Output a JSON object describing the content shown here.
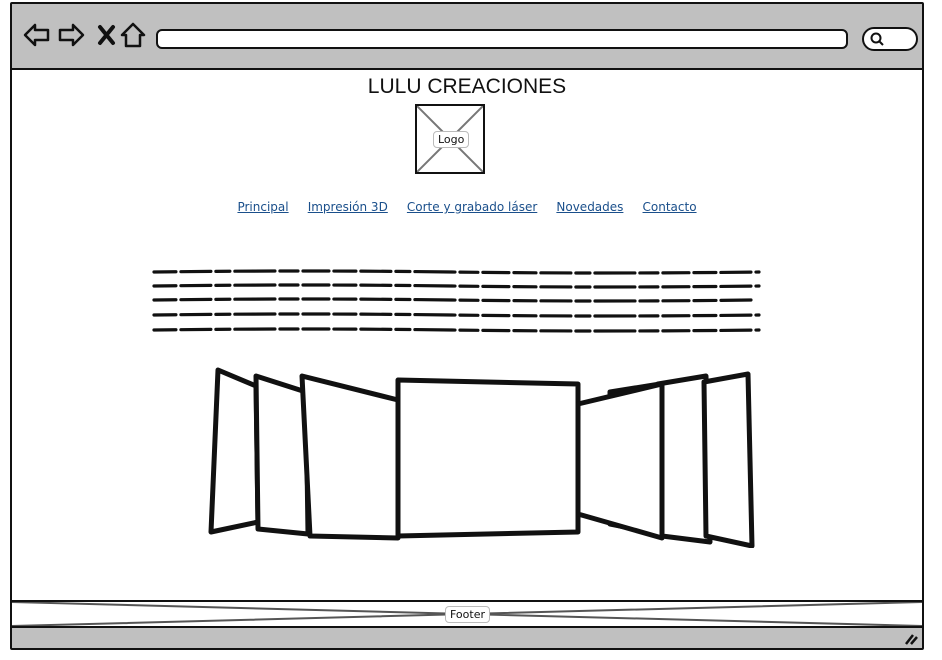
{
  "site": {
    "title": "LULU CREACIONES",
    "logo_label": "Logo"
  },
  "nav": {
    "items": [
      {
        "label": "Principal"
      },
      {
        "label": "Impresión 3D"
      },
      {
        "label": "Corte y grabado láser"
      },
      {
        "label": "Novedades"
      },
      {
        "label": "Contacto"
      }
    ]
  },
  "footer": {
    "label": "Footer"
  },
  "browser": {
    "icons": [
      "back-arrow-icon",
      "forward-arrow-icon",
      "close-icon",
      "home-icon",
      "search-icon",
      "resize-grip-icon"
    ]
  },
  "colors": {
    "chrome": "#c0c0c0",
    "link": "#1a4f8b",
    "stroke": "#111111"
  }
}
